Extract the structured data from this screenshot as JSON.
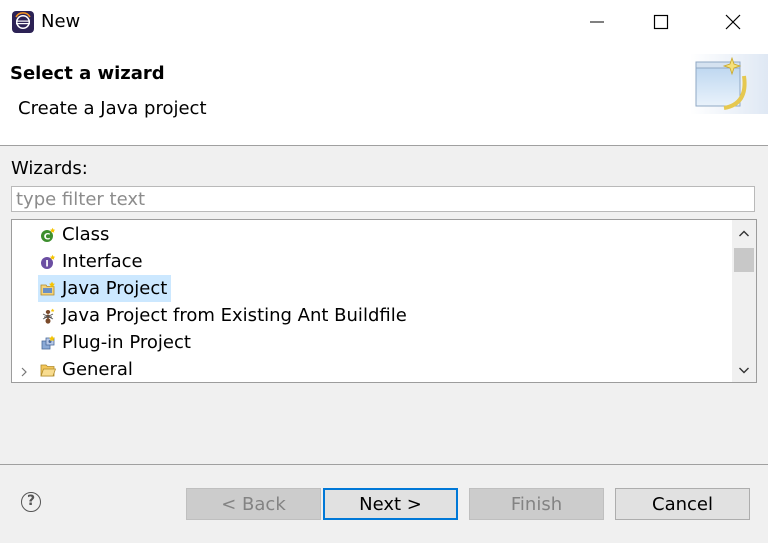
{
  "window": {
    "title": "New",
    "icon": "eclipse-app-icon",
    "controls": [
      "minimize-icon",
      "maximize-icon",
      "close-icon"
    ]
  },
  "header": {
    "title": "Select a wizard",
    "description": "Create a Java project",
    "banner_icon": "new-wizard-banner-icon"
  },
  "wizards": {
    "label": "Wizards:",
    "filter_placeholder": "type filter text",
    "filter_value": "",
    "items": [
      {
        "label": "Class",
        "icon": "java-class-icon",
        "selected": false
      },
      {
        "label": "Interface",
        "icon": "java-interface-icon",
        "selected": false
      },
      {
        "label": "Java Project",
        "icon": "java-project-icon",
        "selected": true
      },
      {
        "label": "Java Project from Existing Ant Buildfile",
        "icon": "ant-icon",
        "selected": false
      },
      {
        "label": "Plug-in Project",
        "icon": "plugin-project-icon",
        "selected": false
      },
      {
        "label": "General",
        "icon": "folder-icon",
        "selected": false,
        "expandable": true
      }
    ]
  },
  "footer": {
    "help_icon": "help-icon",
    "help_glyph": "?",
    "back_label": "< Back",
    "next_label": "Next >",
    "finish_label": "Finish",
    "cancel_label": "Cancel"
  },
  "colors": {
    "selection": "#cce8ff",
    "default_button_border": "#0078d7",
    "window_background": "#f0f0f0"
  }
}
